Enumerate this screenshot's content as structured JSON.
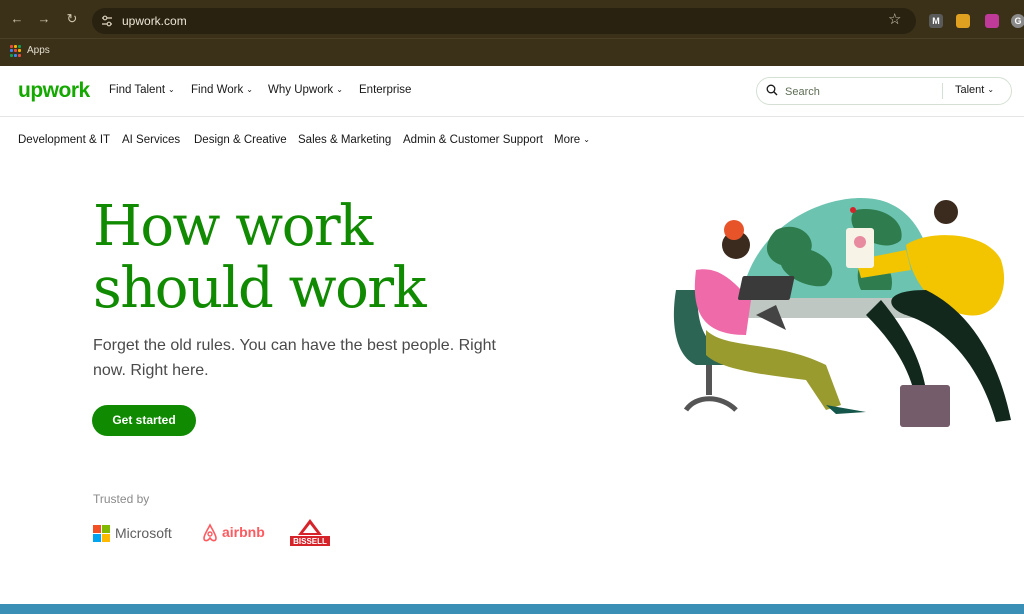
{
  "browser": {
    "url": "upwork.com",
    "bookmarks_label": "Apps",
    "ext_icons": [
      "M",
      "",
      "",
      "G"
    ]
  },
  "header": {
    "logo": "upwork",
    "nav": [
      {
        "label": "Find Talent",
        "dropdown": true
      },
      {
        "label": "Find Work",
        "dropdown": true
      },
      {
        "label": "Why Upwork",
        "dropdown": true
      },
      {
        "label": "Enterprise",
        "dropdown": false
      }
    ],
    "search_placeholder": "Search",
    "search_scope": "Talent"
  },
  "categories": [
    "Development & IT",
    "AI Services",
    "Design & Creative",
    "Sales & Marketing",
    "Admin & Customer Support",
    "More"
  ],
  "hero": {
    "title_line1": "How work",
    "title_line2": "should work",
    "subtitle": "Forget the old rules. You can have the best people. Right now. Right here.",
    "cta_label": "Get started",
    "trusted_label": "Trusted by",
    "logos": [
      "Microsoft",
      "airbnb",
      "BISSELL"
    ]
  },
  "colors": {
    "brand_green": "#14a800",
    "cta_green": "#108a00",
    "chrome_bg": "#3b3118",
    "airbnb_red": "#ff5a60"
  }
}
